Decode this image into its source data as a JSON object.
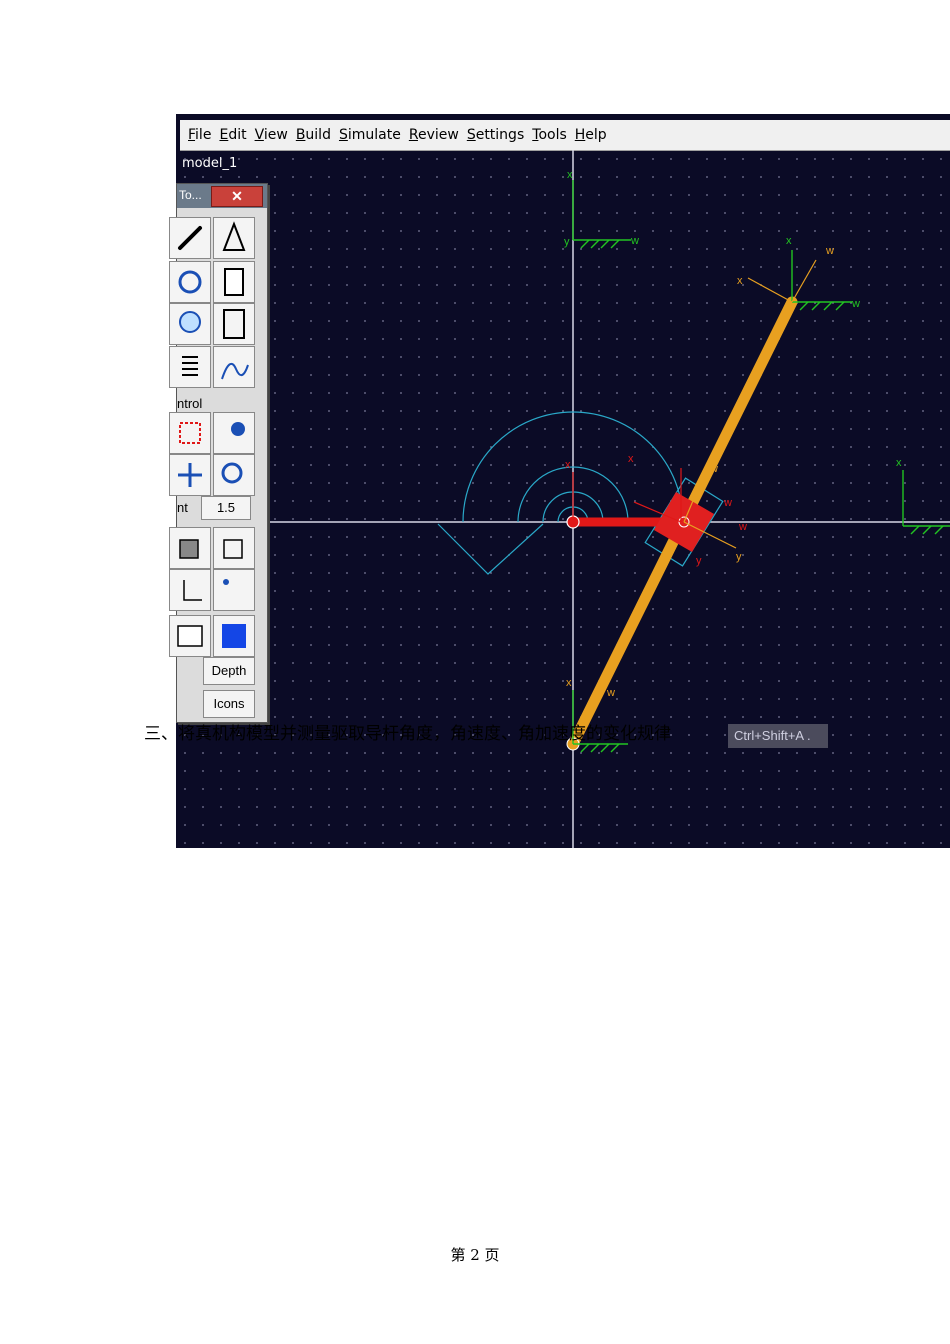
{
  "menu": [
    "File",
    "Edit",
    "View",
    "Build",
    "Simulate",
    "Review",
    "Settings",
    "Tools",
    "Help"
  ],
  "model_name": "model_1",
  "toolbox": {
    "title": "To...",
    "close": "✕",
    "control_label": "ntrol",
    "increment_label": "nt",
    "increment_value": "1.5",
    "depth_label": "Depth",
    "icons_label": "Icons"
  },
  "axis_labels": {
    "x": "x",
    "y": "y",
    "w": "w"
  },
  "document": {
    "step_line": "三、将真机构模型并测量驱取导杆角度，角速度、角加速度的变化规律",
    "shortcut_hint": "Ctrl+Shift+A .",
    "page_number": "第 2 页"
  },
  "colors": {
    "canvas_bg": "#0b0b26",
    "crank": "#e01818",
    "slider": "#e02020",
    "link": "#e8a020",
    "axis_green": "#22c422",
    "wire_cyan": "#2aa8c8"
  }
}
